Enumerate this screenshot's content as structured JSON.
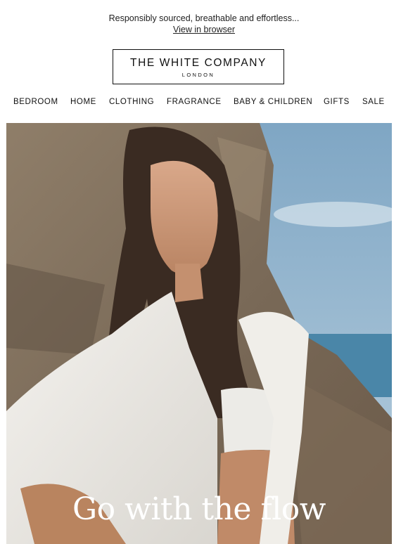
{
  "preheader": {
    "text": "Responsibly sourced, breathable and effortless...",
    "link": "View in browser"
  },
  "logo": {
    "brand": "THE WHITE COMPANY",
    "city": "LONDON"
  },
  "nav": {
    "items": [
      "BEDROOM",
      "HOME",
      "CLOTHING",
      "FRAGRANCE",
      "BABY & CHILDREN",
      "GIFTS",
      "SALE"
    ]
  },
  "hero": {
    "headline": "Go with the flow",
    "image": "woman-in-white-linen-shirt-against-rock-by-sea"
  }
}
